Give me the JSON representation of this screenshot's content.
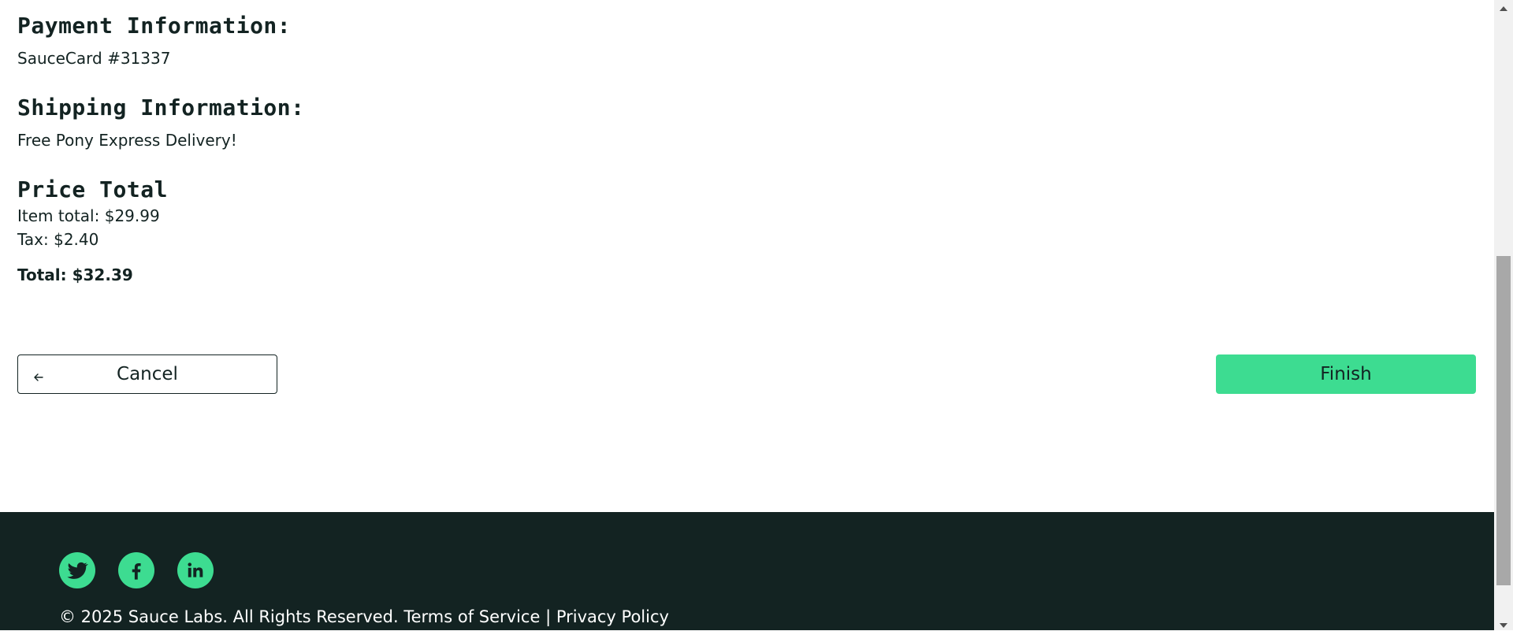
{
  "summary": {
    "payment_title": "Payment Information:",
    "payment_value": "SauceCard #31337",
    "shipping_title": "Shipping Information:",
    "shipping_value": "Free Pony Express Delivery!",
    "price_title": "Price Total",
    "item_total": "Item total: $29.99",
    "tax": "Tax: $2.40",
    "total": "Total: $32.39"
  },
  "actions": {
    "cancel_label": "Cancel",
    "finish_label": "Finish"
  },
  "footer": {
    "social": [
      {
        "name": "twitter-icon"
      },
      {
        "name": "facebook-icon"
      },
      {
        "name": "linkedin-icon"
      }
    ],
    "copy": "© 2025 Sauce Labs. All Rights Reserved. Terms of Service | Privacy Policy"
  },
  "colors": {
    "accent": "#3ddc91",
    "dark": "#132322",
    "scrollbar_track": "#f1f1f1",
    "scrollbar_thumb": "#a8a8a8"
  }
}
